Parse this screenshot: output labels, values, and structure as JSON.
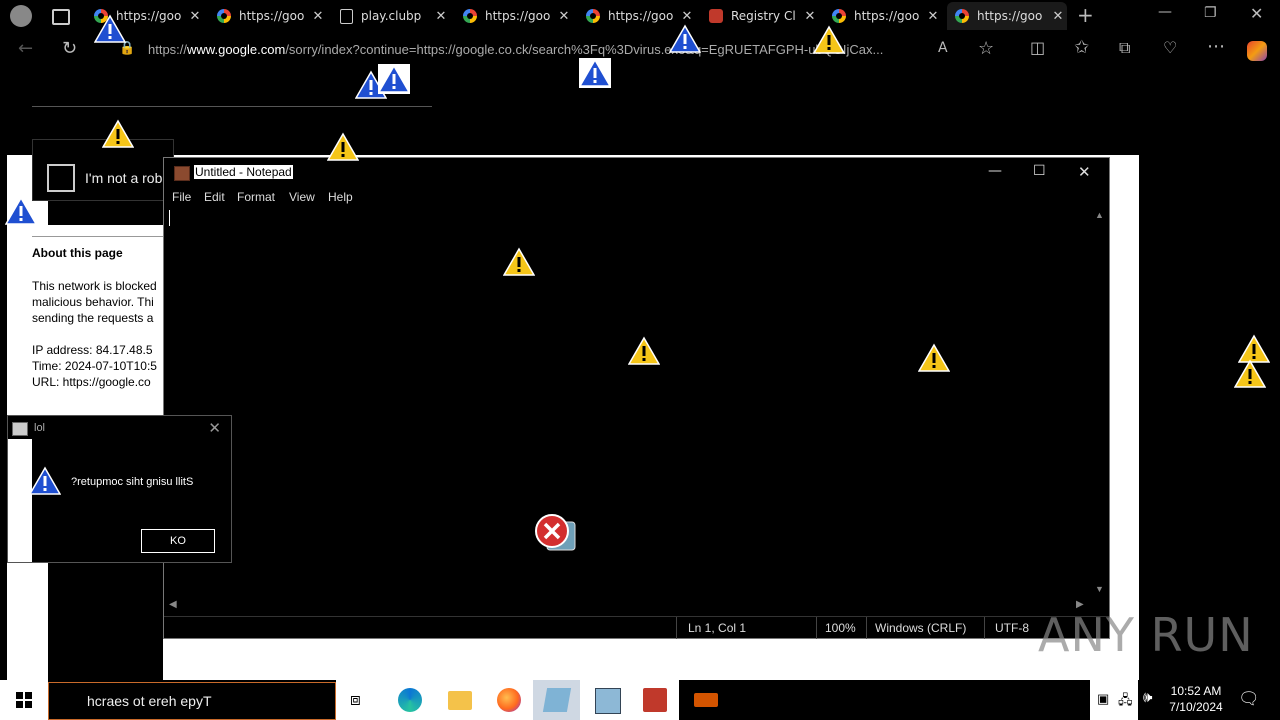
{
  "tabs": [
    {
      "label": "https://goo",
      "favicon": "google-icon"
    },
    {
      "label": "https://goo",
      "favicon": "google-icon"
    },
    {
      "label": "play.clubp",
      "favicon": "page-icon"
    },
    {
      "label": "https://goo",
      "favicon": "google-icon"
    },
    {
      "label": "https://goo",
      "favicon": "google-icon"
    },
    {
      "label": "Registry Cl",
      "favicon": "registry-icon"
    },
    {
      "label": "https://goo",
      "favicon": "google-icon"
    },
    {
      "label": "https://goo",
      "favicon": "google-icon"
    }
  ],
  "address": {
    "prefix": "https://",
    "host": "www.google.com",
    "rest": "/sorry/index?continue=https://google.co.ck/search%3Fq%3Dvirus.exe&q=EgRUETAFGPH-ubQGIjCax..."
  },
  "page": {
    "recaptcha_label": "I'm not a robot",
    "about_heading": "About this page",
    "about_lines": [
      "This network is blocked",
      "malicious behavior. Thi",
      "sending the requests a"
    ],
    "ip_line": "IP address: 84.17.48.5",
    "time_line": "Time: 2024-07-10T10:5",
    "url_line": "URL: https://google.co"
  },
  "notepad": {
    "title": "Untitled - Notepad",
    "menu": [
      "File",
      "Edit",
      "Format",
      "View",
      "Help"
    ],
    "status": {
      "position": "Ln 1, Col 1",
      "zoom": "100%",
      "line_ending": "Windows (CRLF)",
      "encoding": "UTF-8"
    }
  },
  "dialog": {
    "title": "lol",
    "message": "?retupmoc siht gnisu llitS",
    "ok_label": "KO"
  },
  "taskbar": {
    "search_placeholder": "hcraes ot ereh epyT",
    "time": "10:52 AM",
    "date": "7/10/2024"
  },
  "watermark": "ANY RUN",
  "colors": {
    "warning": "#f5c518",
    "info": "#1f4fd1",
    "error": "#d32f2f",
    "search_border": "#c96a2a"
  }
}
